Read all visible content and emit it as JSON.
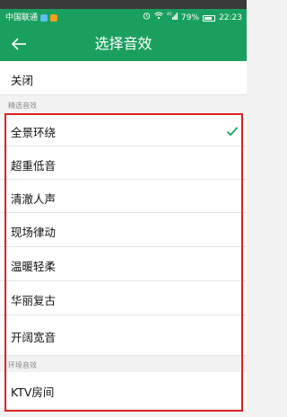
{
  "status_bar": {
    "carrier": "中国联通",
    "battery_percent": "79%",
    "time": "22:23",
    "network": "4G"
  },
  "nav": {
    "title": "选择音效",
    "back_icon": "arrow-left-icon"
  },
  "top_option": {
    "label": "关闭"
  },
  "sections": [
    {
      "header": "精选音效",
      "items": [
        {
          "label": "全景环绕",
          "selected": true
        },
        {
          "label": "超重低音",
          "selected": false
        },
        {
          "label": "清澈人声",
          "selected": false
        },
        {
          "label": "现场律动",
          "selected": false
        },
        {
          "label": "温暖轻柔",
          "selected": false
        },
        {
          "label": "华丽复古",
          "selected": false
        },
        {
          "label": "开阔宽音",
          "selected": false
        }
      ]
    },
    {
      "header": "环境音效",
      "items": [
        {
          "label": "KTV房间",
          "selected": false
        }
      ]
    }
  ],
  "colors": {
    "brand_green": "#1aa05e",
    "check_green": "#1aa05e",
    "highlight_red": "#e02020"
  }
}
